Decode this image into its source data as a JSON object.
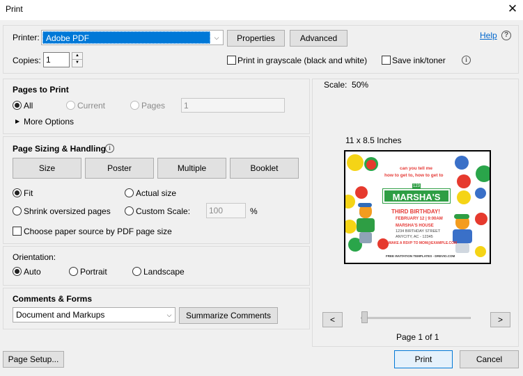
{
  "window": {
    "title": "Print",
    "close_symbol": "✕"
  },
  "printer": {
    "label": "Printer:",
    "selected": "Adobe PDF",
    "properties_label": "Properties",
    "advanced_label": "Advanced",
    "help_label": "Help",
    "help_icon": "?"
  },
  "copies": {
    "label": "Copies:",
    "value": "1",
    "grayscale_label": "Print in grayscale (black and white)",
    "save_ink_label": "Save ink/toner"
  },
  "pages_to_print": {
    "heading": "Pages to Print",
    "all_label": "All",
    "current_label": "Current",
    "pages_label": "Pages",
    "pages_value": "1",
    "more_options_label": "More Options"
  },
  "sizing": {
    "heading": "Page Sizing & Handling",
    "buttons": [
      "Size",
      "Poster",
      "Multiple",
      "Booklet"
    ],
    "fit_label": "Fit",
    "actual_size_label": "Actual size",
    "shrink_label": "Shrink oversized pages",
    "custom_scale_label": "Custom Scale:",
    "custom_scale_value": "100",
    "percent_label": "%",
    "paper_source_label": "Choose paper source by PDF page size"
  },
  "orientation": {
    "heading": "Orientation:",
    "auto_label": "Auto",
    "portrait_label": "Portrait",
    "landscape_label": "Landscape"
  },
  "comments": {
    "heading": "Comments & Forms",
    "selected": "Document and Markups",
    "summarize_label": "Summarize Comments"
  },
  "preview": {
    "scale_text": "Scale:  50%",
    "paper_size": "11 x 8.5 Inches",
    "page_indicator": "Page 1 of 1",
    "prev_symbol": "<",
    "next_symbol": ">",
    "slider_position": 0,
    "invite": {
      "question_line1": "can you tell me",
      "question_line2": "how to get to, how to get to",
      "street_number": "123",
      "name": "MARSHA'S",
      "occasion": "THIRD BIRTHDAY!",
      "date": "FEBRUARY 12 | 9:00AM",
      "venue": "MARSHA'S HOUSE",
      "address1": "1234 BIRTHDAY STREET",
      "address2": "ANYCITY, AC - 12345",
      "rsvp": "MAKE A RSVP TO MOM@EXAMPLE.COM",
      "footer": "FREE INVITATION TEMPLATES - DREVIO.COM"
    }
  },
  "footer": {
    "page_setup_label": "Page Setup...",
    "print_label": "Print",
    "cancel_label": "Cancel"
  },
  "colors": {
    "accent_blue": "#0078d7",
    "selection_blue": "#0078d7",
    "invite_green": "#2e9e44",
    "invite_red": "#e53935"
  }
}
